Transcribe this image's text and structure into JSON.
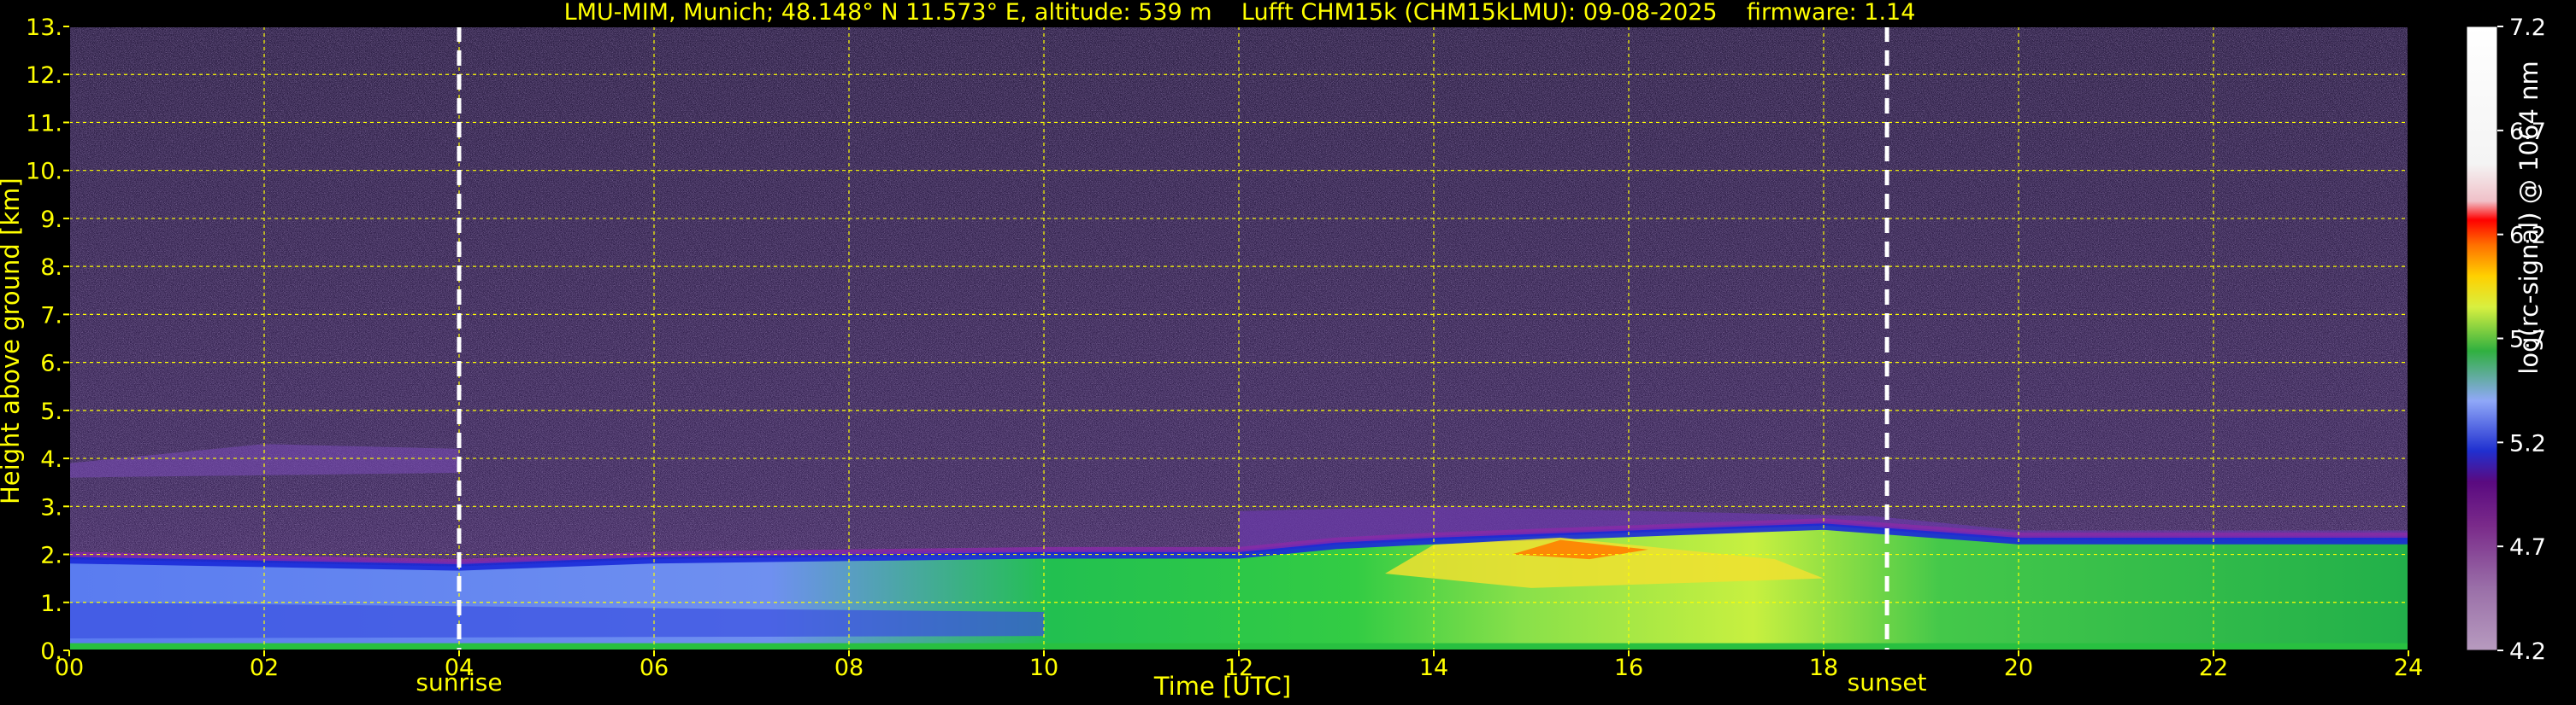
{
  "title": "LMU-MIM, Munich; 48.148° N 11.573° E, altitude: 539 m    Lufft CHM15k (CHM15kLMU): 09-08-2025    firmware: 1.14",
  "chart_data": {
    "type": "heatmap",
    "xlabel": "Time [UTC]",
    "ylabel": "Height above ground [km]",
    "xlim": [
      0,
      24
    ],
    "ylim": [
      0,
      13
    ],
    "x_ticks": [
      "00",
      "02",
      "04",
      "06",
      "08",
      "10",
      "12",
      "14",
      "16",
      "18",
      "20",
      "22",
      "24"
    ],
    "y_ticks": [
      "0.",
      "1.",
      "2.",
      "3.",
      "4.",
      "5.",
      "6.",
      "7.",
      "8.",
      "9.",
      "10.",
      "11.",
      "12.",
      "13."
    ],
    "grid": true,
    "grid_color": "#ffff00",
    "events": [
      {
        "label": "sunrise",
        "x": 4.0
      },
      {
        "label": "sunset",
        "x": 18.65
      }
    ],
    "colorbar": {
      "label": "log(rc-signal) @ 1064 nm",
      "range": [
        4.2,
        7.2
      ],
      "ticks": [
        "4.2",
        "4.7",
        "5.2",
        "5.7",
        "6.2",
        "6.7",
        "7.2"
      ]
    },
    "layers": [
      {
        "name": "boundary layer top (blue)",
        "height_km": [
          [
            0,
            1.9
          ],
          [
            4,
            1.75
          ],
          [
            6,
            1.9
          ],
          [
            10,
            2.0
          ],
          [
            12,
            2.0
          ],
          [
            13,
            2.2
          ],
          [
            14,
            2.3
          ],
          [
            18,
            2.6
          ],
          [
            20,
            2.3
          ],
          [
            22,
            2.3
          ],
          [
            24,
            2.3
          ]
        ]
      },
      {
        "name": "aerosol layer (yellow/orange)",
        "height_km": [
          [
            14,
            2.2
          ],
          [
            15.3,
            2.35
          ],
          [
            16.5,
            2.1
          ],
          [
            17.5,
            1.9
          ]
        ]
      },
      {
        "name": "residual layer top",
        "height_km": [
          [
            12,
            2.9
          ],
          [
            14,
            3.0
          ],
          [
            18.5,
            2.8
          ],
          [
            20,
            2.5
          ],
          [
            24,
            2.5
          ]
        ]
      },
      {
        "name": "elevated aerosol",
        "height_km": [
          [
            0,
            3.9
          ],
          [
            2,
            4.3
          ],
          [
            4,
            4.2
          ]
        ]
      }
    ]
  }
}
